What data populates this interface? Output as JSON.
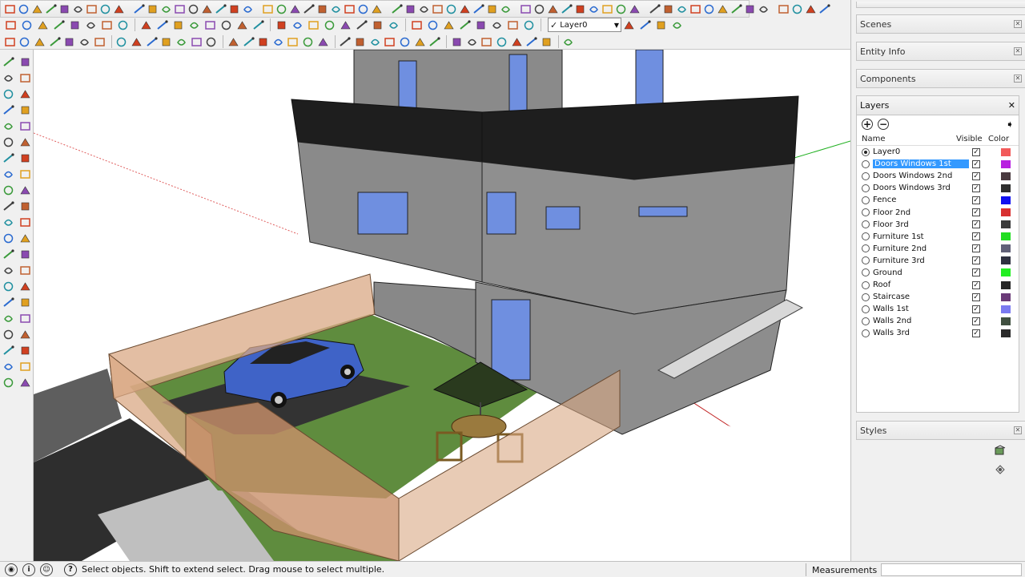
{
  "toolbar": {
    "layer_dropdown_value": "Layer0",
    "row1_icons": [
      "file-icon",
      "save-icon",
      "cut-icon",
      "copy-icon",
      "paste-icon",
      "erase-icon",
      "undo-icon",
      "redo-icon",
      "print-icon",
      "model-info-icon",
      "select-icon",
      "paint-icon",
      "eraser-icon",
      "rectangle-icon",
      "line-icon",
      "circle-icon",
      "arc-icon",
      "polygon-icon",
      "freehand-icon",
      "move-icon",
      "pushpull-icon",
      "rotate-icon",
      "followme-icon",
      "scale-icon",
      "offset-icon",
      "tape-icon",
      "dimension-icon",
      "protractor-icon",
      "text-icon",
      "axes-icon",
      "3dtext-icon",
      "orbit-icon",
      "pan-icon",
      "zoom-icon",
      "zoom-window-icon",
      "zoom-extents-icon",
      "previous-icon",
      "next-icon",
      "iso-view-icon",
      "top-view-icon",
      "front-view-icon",
      "right-view-icon",
      "back-view-icon",
      "left-view-icon",
      "xray-icon",
      "wireframe-icon",
      "hidden-line-icon",
      "shaded-icon",
      "textured-icon",
      "monochrome-icon",
      "section-plane-icon",
      "section-display-icon",
      "section-cut-icon",
      "shadows-icon",
      "fog-icon",
      "get-models-icon",
      "share-model-icon",
      "share-component-icon"
    ],
    "row2_icons": [
      "sandbox-from-contours-icon",
      "sandbox-from-scratch-icon",
      "smoove-icon",
      "stamp-icon",
      "drape-icon",
      "add-detail-icon",
      "flip-edge-icon",
      "section-icon",
      "delete-icon",
      "match-photo-icon",
      "walk-icon",
      "look-around-icon",
      "position-camera-icon",
      "intersect-icon",
      "union-icon",
      "subtract-icon",
      "trim-icon",
      "split-icon",
      "outer-shell-icon",
      "layers-icon",
      "component-icon",
      "group-icon",
      "solid-icon",
      "styles-icon",
      "dimension-style-icon",
      "label-icon",
      "warehouse-icon",
      "extension-icon",
      "geo-icon",
      "photo-texture-icon",
      "add-location-icon",
      "toggle-terrain-icon",
      "preview-icon",
      "ruby-icon",
      "layer-manager-icon",
      "color-by-layer-icon"
    ],
    "row3_icons": [
      "grid-icon",
      "point-icon",
      "sphere-icon",
      "cone-icon",
      "cylinder-icon",
      "torus-icon",
      "prism-icon",
      "pyramid-icon",
      "extrude-icon",
      "loft-icon",
      "sweep-icon",
      "joint-push-pull-icon",
      "vector-push-pull-icon",
      "normal-push-pull-icon",
      "round-corner-icon",
      "bevel-icon",
      "chamfer-icon",
      "fillet-icon",
      "weld-icon",
      "explode-icon",
      "flatten-icon",
      "drape-curve-icon",
      "soften-icon",
      "smooth-icon",
      "paint-bucket-icon",
      "random-color-icon",
      "material-icon",
      "texture-icon",
      "uv-map-icon",
      "component-options-icon",
      "dynamic-component-icon",
      "interact-icon",
      "scene-icon",
      "animation-icon",
      "export-icon",
      "render-icon"
    ]
  },
  "palette_icons": [
    "select-icon",
    "line-icon",
    "paint-icon",
    "eraser-icon",
    "rectangle-icon",
    "circle-icon",
    "polygon-icon",
    "arc-icon",
    "freehand-icon",
    "move-icon",
    "pushpull-icon",
    "rotate-icon",
    "followme-icon",
    "scale-icon",
    "offset-icon",
    "tape-icon",
    "dimension-icon",
    "protractor-icon",
    "text-icon",
    "axes-icon",
    "3dtext-icon",
    "section-icon",
    "orbit-icon",
    "pan-icon",
    "zoom-icon",
    "zoom-window-icon",
    "zoom-extents-icon",
    "previous-icon",
    "walk-icon",
    "look-around-icon",
    "position-camera-icon",
    "sandbox-icon",
    "contour-icon",
    "smoove-icon",
    "stamp-icon",
    "drape-icon",
    "add-detail-icon",
    "flip-edge-icon",
    "warehouse-icon",
    "share-icon",
    "solid-icon",
    "location-icon"
  ],
  "tray": {
    "scenes": "Scenes",
    "entity_info": "Entity Info",
    "components": "Components",
    "layers_title": "Layers",
    "col_name": "Name",
    "col_visible": "Visible",
    "col_color": "Color",
    "styles": "Styles",
    "layers": [
      {
        "name": "Layer0",
        "active": true,
        "selected": false,
        "visible": true,
        "color": "#f25a5a"
      },
      {
        "name": "Doors Windows 1st",
        "active": false,
        "selected": true,
        "visible": true,
        "color": "#b81fe0"
      },
      {
        "name": "Doors Windows 2nd",
        "active": false,
        "selected": false,
        "visible": true,
        "color": "#4a3a40"
      },
      {
        "name": "Doors Windows 3rd",
        "active": false,
        "selected": false,
        "visible": true,
        "color": "#2e2e2e"
      },
      {
        "name": "Fence",
        "active": false,
        "selected": false,
        "visible": true,
        "color": "#1010f0"
      },
      {
        "name": "Floor 2nd",
        "active": false,
        "selected": false,
        "visible": true,
        "color": "#d83030"
      },
      {
        "name": "Floor 3rd",
        "active": false,
        "selected": false,
        "visible": true,
        "color": "#3a3a3a"
      },
      {
        "name": "Furniture 1st",
        "active": false,
        "selected": false,
        "visible": true,
        "color": "#22dd22"
      },
      {
        "name": "Furniture 2nd",
        "active": false,
        "selected": false,
        "visible": true,
        "color": "#606078"
      },
      {
        "name": "Furniture 3rd",
        "active": false,
        "selected": false,
        "visible": true,
        "color": "#2e3040"
      },
      {
        "name": "Ground",
        "active": false,
        "selected": false,
        "visible": true,
        "color": "#22ee22"
      },
      {
        "name": "Roof",
        "active": false,
        "selected": false,
        "visible": true,
        "color": "#262626"
      },
      {
        "name": "Staircase",
        "active": false,
        "selected": false,
        "visible": true,
        "color": "#6a3a78"
      },
      {
        "name": "Walls 1st",
        "active": false,
        "selected": false,
        "visible": true,
        "color": "#7a7af0"
      },
      {
        "name": "Walls 2nd",
        "active": false,
        "selected": false,
        "visible": true,
        "color": "#405040"
      },
      {
        "name": "Walls 3rd",
        "active": false,
        "selected": false,
        "visible": true,
        "color": "#2a2a2a"
      }
    ]
  },
  "status": {
    "hint": "Select objects. Shift to extend select. Drag mouse to select multiple.",
    "measurements_label": "Measurements"
  },
  "colors": {
    "wall": "#8a8a8a",
    "window": "#6f8fe0",
    "grass": "#5f8c3e",
    "fence": "#d9a884",
    "road": "#3c3c3c",
    "car": "#3f63c7"
  }
}
